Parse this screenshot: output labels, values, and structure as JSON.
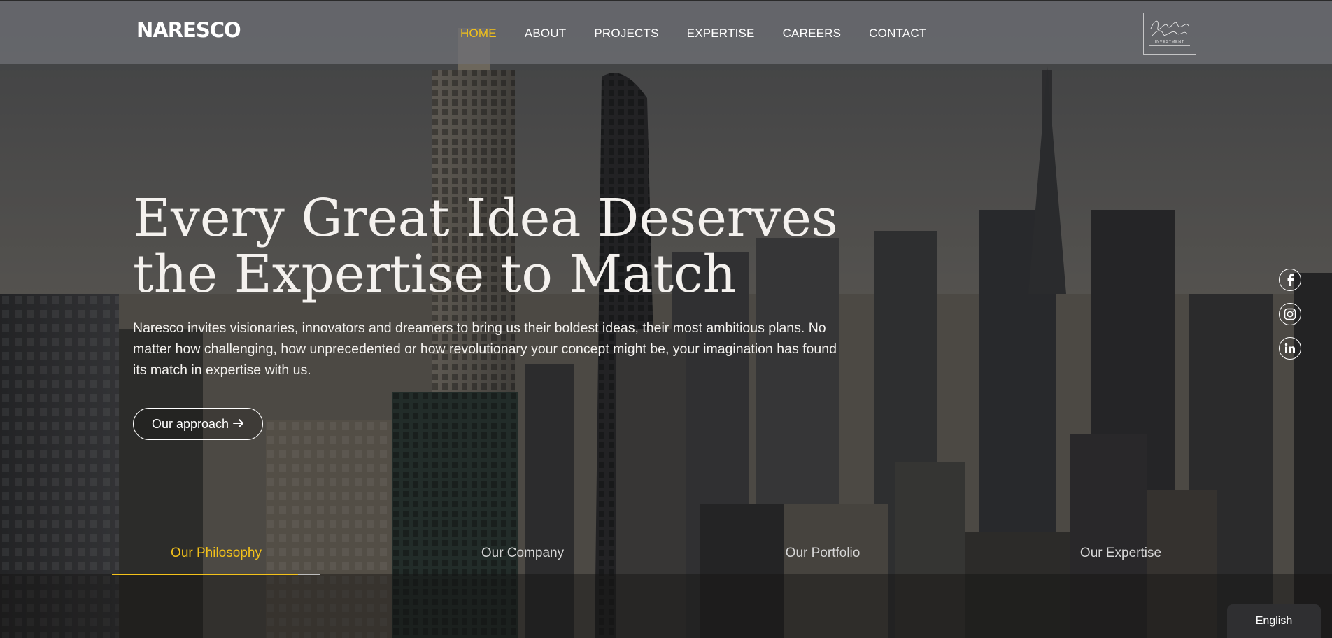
{
  "brand": {
    "logo_text": "NARESCO"
  },
  "nav": {
    "items": [
      {
        "label": "HOME",
        "active": true
      },
      {
        "label": "ABOUT",
        "active": false
      },
      {
        "label": "PROJECTS",
        "active": false
      },
      {
        "label": "EXPERTISE",
        "active": false
      },
      {
        "label": "CAREERS",
        "active": false
      },
      {
        "label": "CONTACT",
        "active": false
      }
    ]
  },
  "partner_badge": {
    "caption": "INVESTMENT"
  },
  "hero": {
    "title": "Every Great Idea Deserves the Expertise to Match",
    "text": "Naresco invites visionaries, innovators and dreamers to bring us their boldest ideas, their most ambitious plans. No matter how challenging, how unprecedented or how revolutionary your concept might be, your imagination has found its match in expertise with us.",
    "cta_label": "Our approach"
  },
  "social": [
    {
      "icon": "facebook-icon"
    },
    {
      "icon": "instagram-icon"
    },
    {
      "icon": "linkedin-icon"
    }
  ],
  "tabs": [
    {
      "label": "Our Philosophy",
      "active": true
    },
    {
      "label": "Our Company",
      "active": false
    },
    {
      "label": "Our Portfolio",
      "active": false
    },
    {
      "label": "Our Expertise",
      "active": false
    }
  ],
  "language": {
    "selected": "English"
  },
  "colors": {
    "accent": "#f4c21a",
    "header_bg": "#6e7074",
    "text": "#ffffff"
  }
}
